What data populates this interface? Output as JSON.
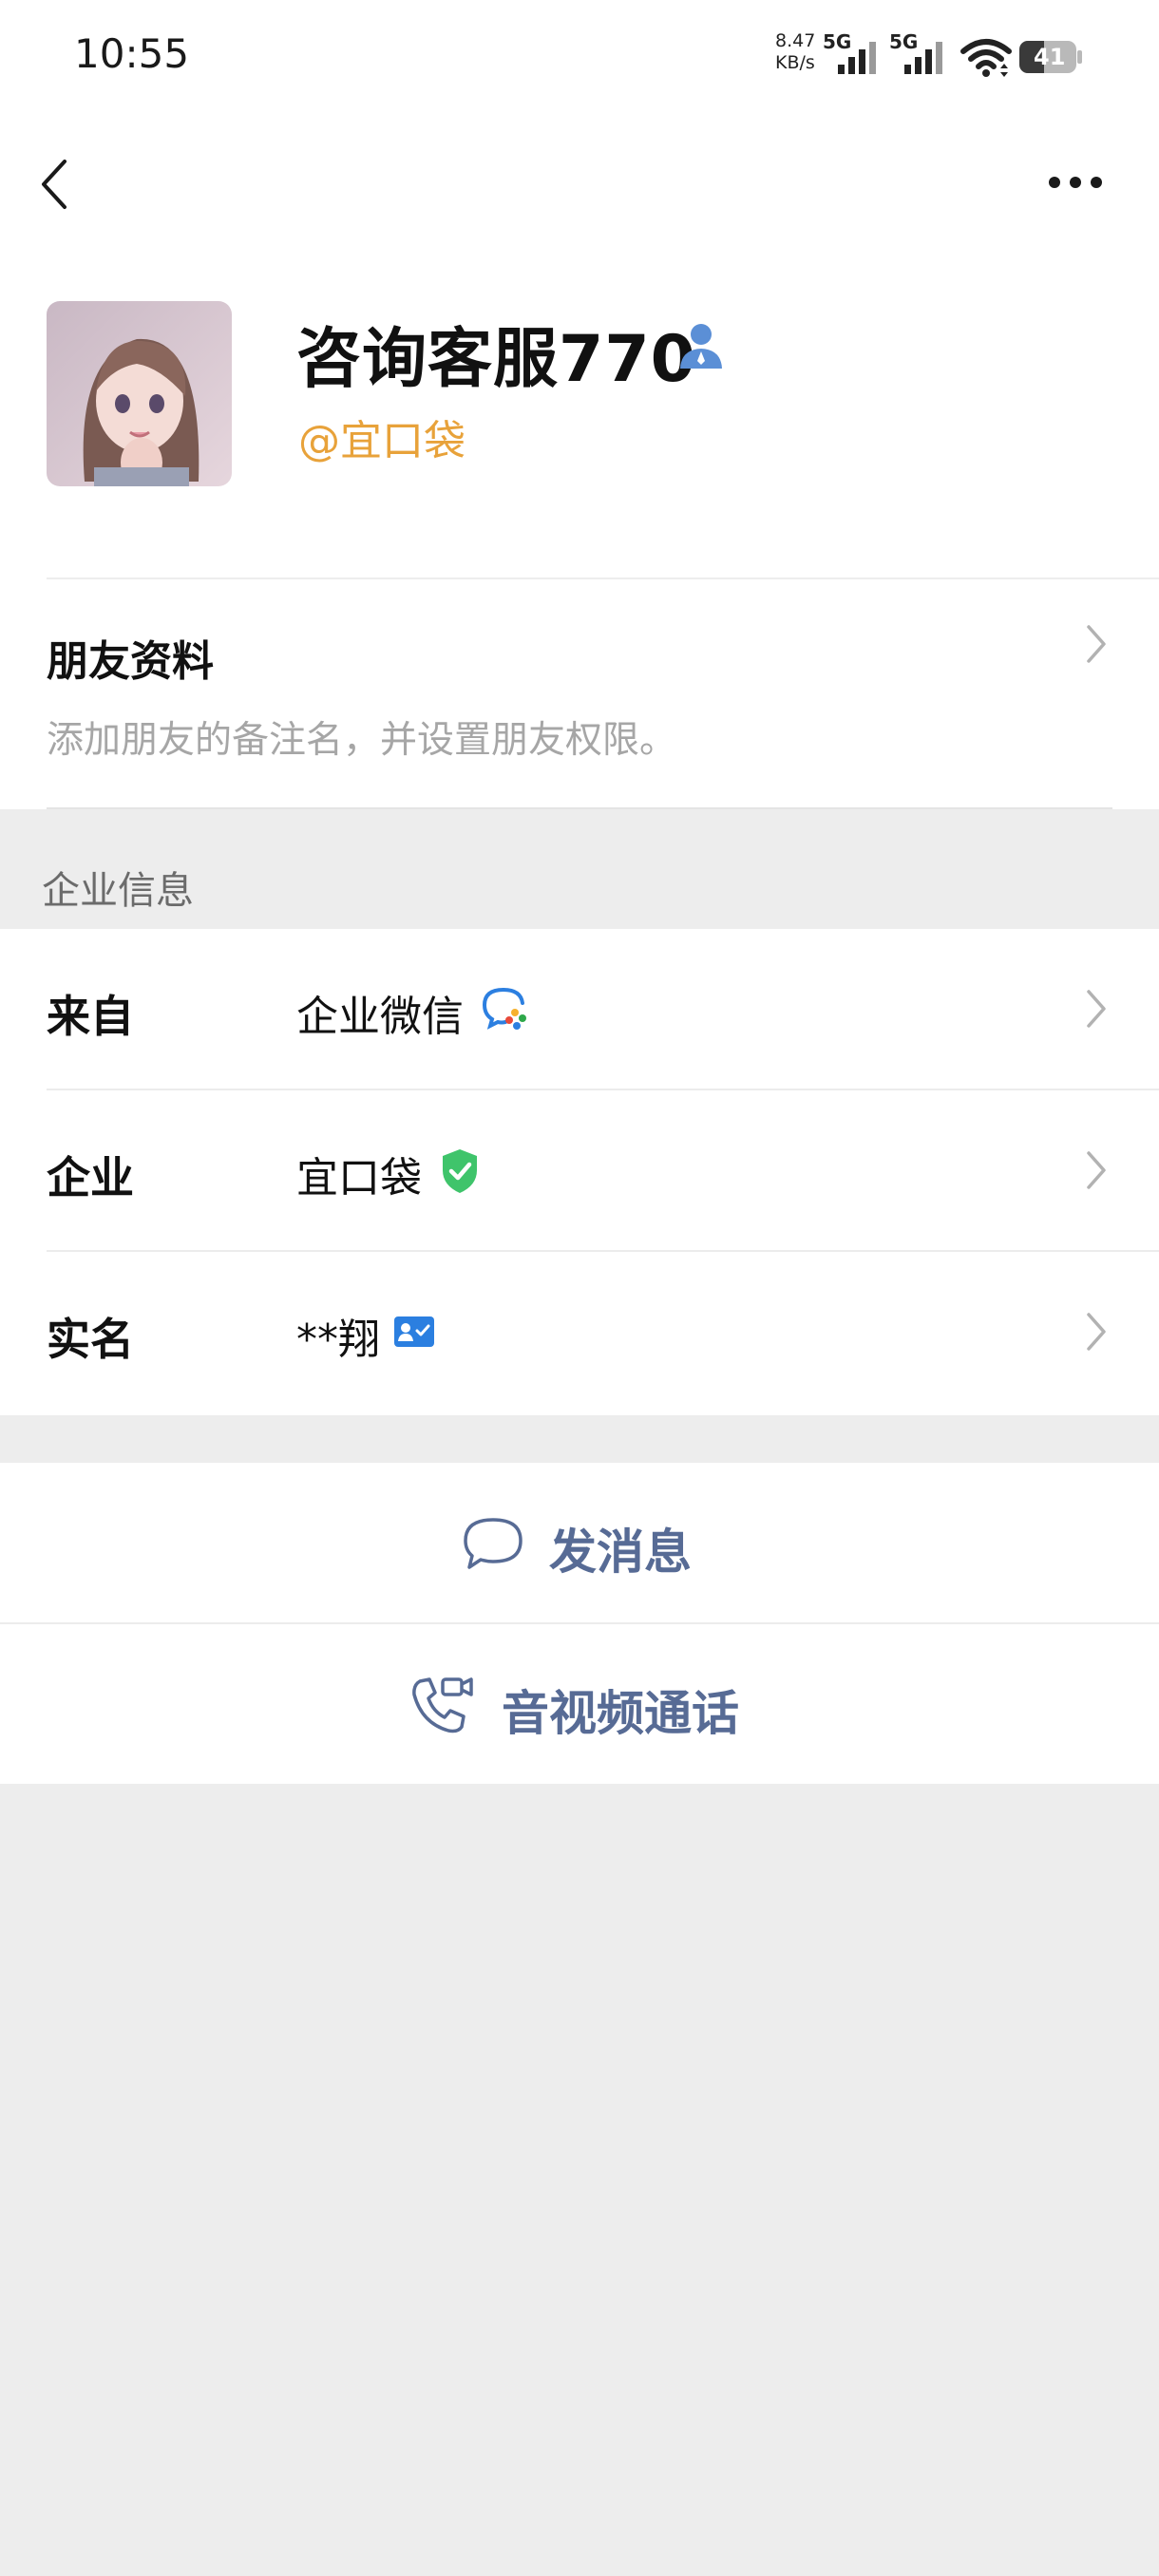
{
  "status_bar": {
    "time": "10:55",
    "net_speed_value": "8.47",
    "net_speed_unit": "KB/s",
    "sim1_label": "5G",
    "sim2_label": "5G",
    "battery": "41"
  },
  "profile": {
    "name": "咨询客服770",
    "company_tag": "@宜口袋"
  },
  "friend_info": {
    "title": "朋友资料",
    "description": "添加朋友的备注名，并设置朋友权限。"
  },
  "enterprise": {
    "section_title": "企业信息",
    "rows": [
      {
        "label": "来自",
        "value": "企业微信",
        "icon": "wecom-icon"
      },
      {
        "label": "企业",
        "value": "宜口袋",
        "icon": "verified-shield-icon"
      },
      {
        "label": "实名",
        "value": "**翔",
        "icon": "id-card-icon"
      }
    ]
  },
  "actions": {
    "message": "发消息",
    "call": "音视频通话"
  },
  "colors": {
    "accent_link": "#576b95",
    "company_tag": "#e8a23a",
    "verified_green": "#3fc46b",
    "id_blue": "#2b7fe0",
    "background": "#ededed"
  }
}
